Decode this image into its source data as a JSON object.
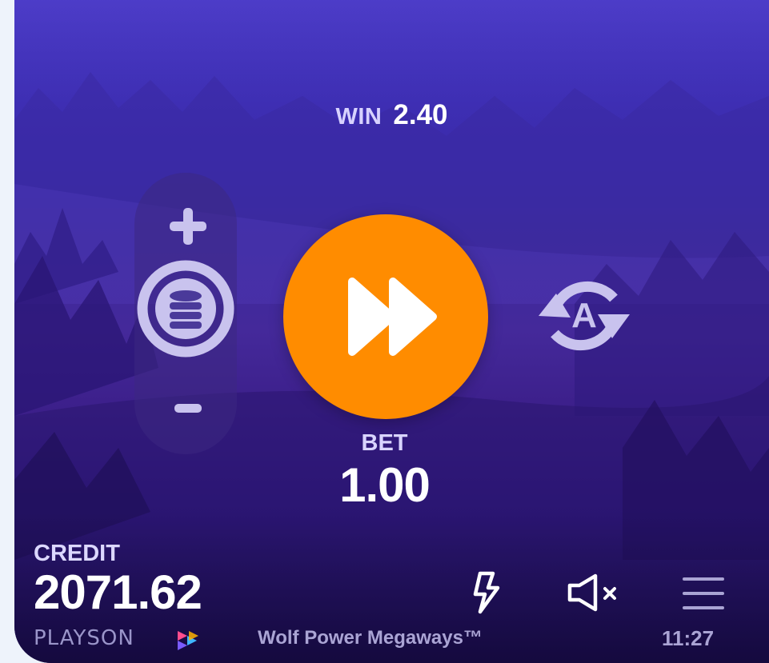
{
  "win": {
    "label": "WIN",
    "value": "2.40"
  },
  "bet": {
    "label": "BET",
    "value": "1.00"
  },
  "credit": {
    "label": "CREDIT",
    "value": "2071.62"
  },
  "footer": {
    "brand": "PLAYSON",
    "game_title": "Wolf Power Megaways™",
    "clock": "11:27"
  },
  "controls": {
    "increase_bet_icon": "plus-icon",
    "bet_select_icon": "coin-stack-icon",
    "decrease_bet_icon": "minus-icon",
    "spin_icon": "fast-forward-icon",
    "autoplay_icon": "autoplay-icon",
    "autoplay_letter": "A",
    "turbo_icon": "lightning-icon",
    "sound_icon": "muted-speaker-icon",
    "menu_icon": "hamburger-menu-icon"
  },
  "colors": {
    "spin_button": "#ff8c00",
    "accent_text": "#d7d2ff",
    "icon_light": "#c9c3ee"
  }
}
